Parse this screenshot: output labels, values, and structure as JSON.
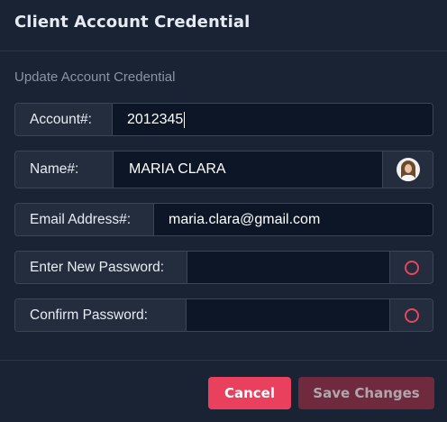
{
  "modal": {
    "title": "Client Account Credential",
    "section_label": "Update Account Credential"
  },
  "fields": {
    "account": {
      "label": "Account#:",
      "value": "2012345"
    },
    "name": {
      "label": "Name#:",
      "value": "MARIA CLARA",
      "avatar_icon": "user-avatar"
    },
    "email": {
      "label": "Email Address#:",
      "value": "maria.clara@gmail.com"
    },
    "new_password": {
      "label": "Enter New Password:",
      "value": "",
      "status_icon": "circle-outline-icon"
    },
    "confirm_password": {
      "label": "Confirm Password:",
      "value": "",
      "status_icon": "circle-outline-icon"
    }
  },
  "footer": {
    "cancel_label": "Cancel",
    "save_label": "Save Changes"
  },
  "colors": {
    "background": "#1a2333",
    "label_bg": "#232d3e",
    "input_bg": "#0d1626",
    "accent": "#e9405e",
    "accent_disabled": "#6f2a3d"
  }
}
